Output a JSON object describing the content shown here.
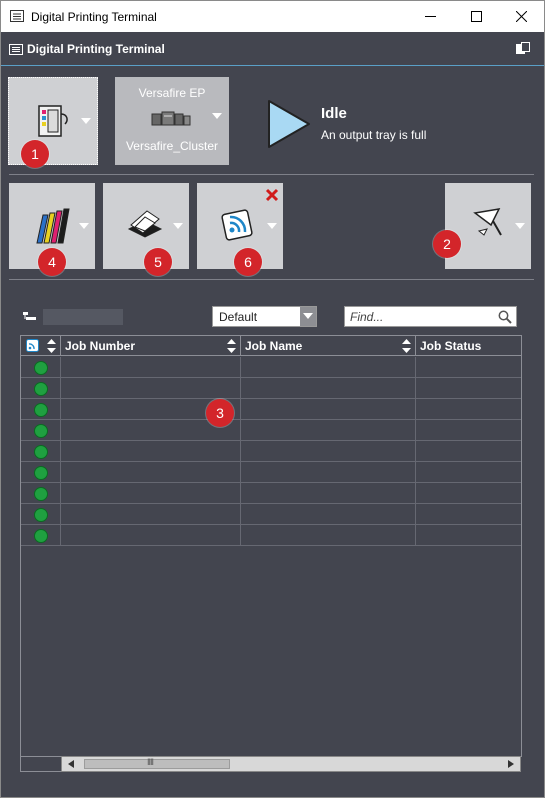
{
  "window": {
    "title": "Digital Printing Terminal",
    "minimize_glyph": "—",
    "maximize_glyph": "☐",
    "close_glyph": "✕"
  },
  "header": {
    "title": "Digital Printing Terminal"
  },
  "printer": {
    "model": "Versafire EP",
    "cluster": "Versafire_Cluster"
  },
  "status": {
    "state": "Idle",
    "message": "An output tray is full"
  },
  "badges": {
    "b1": "1",
    "b2": "2",
    "b3": "3",
    "b4": "4",
    "b5": "5",
    "b6": "6"
  },
  "filter": {
    "selected": "Default",
    "search_placeholder": "Find..."
  },
  "table": {
    "columns": [
      "Job Number",
      "Job Name",
      "Job Status"
    ],
    "rows": [
      {
        "status": "green"
      },
      {
        "status": "green"
      },
      {
        "status": "green"
      },
      {
        "status": "green"
      },
      {
        "status": "green"
      },
      {
        "status": "green"
      },
      {
        "status": "green"
      },
      {
        "status": "green"
      },
      {
        "status": "green"
      }
    ]
  },
  "scrollbar": {
    "thumb_glyph": "IIII"
  },
  "colors": {
    "background": "#43454f",
    "tile": "#cfd0d3",
    "badge": "#d3252a",
    "status_ok": "#1fa040",
    "play_icon": "#a9d9f3",
    "header_rule": "#5aa0c8"
  }
}
